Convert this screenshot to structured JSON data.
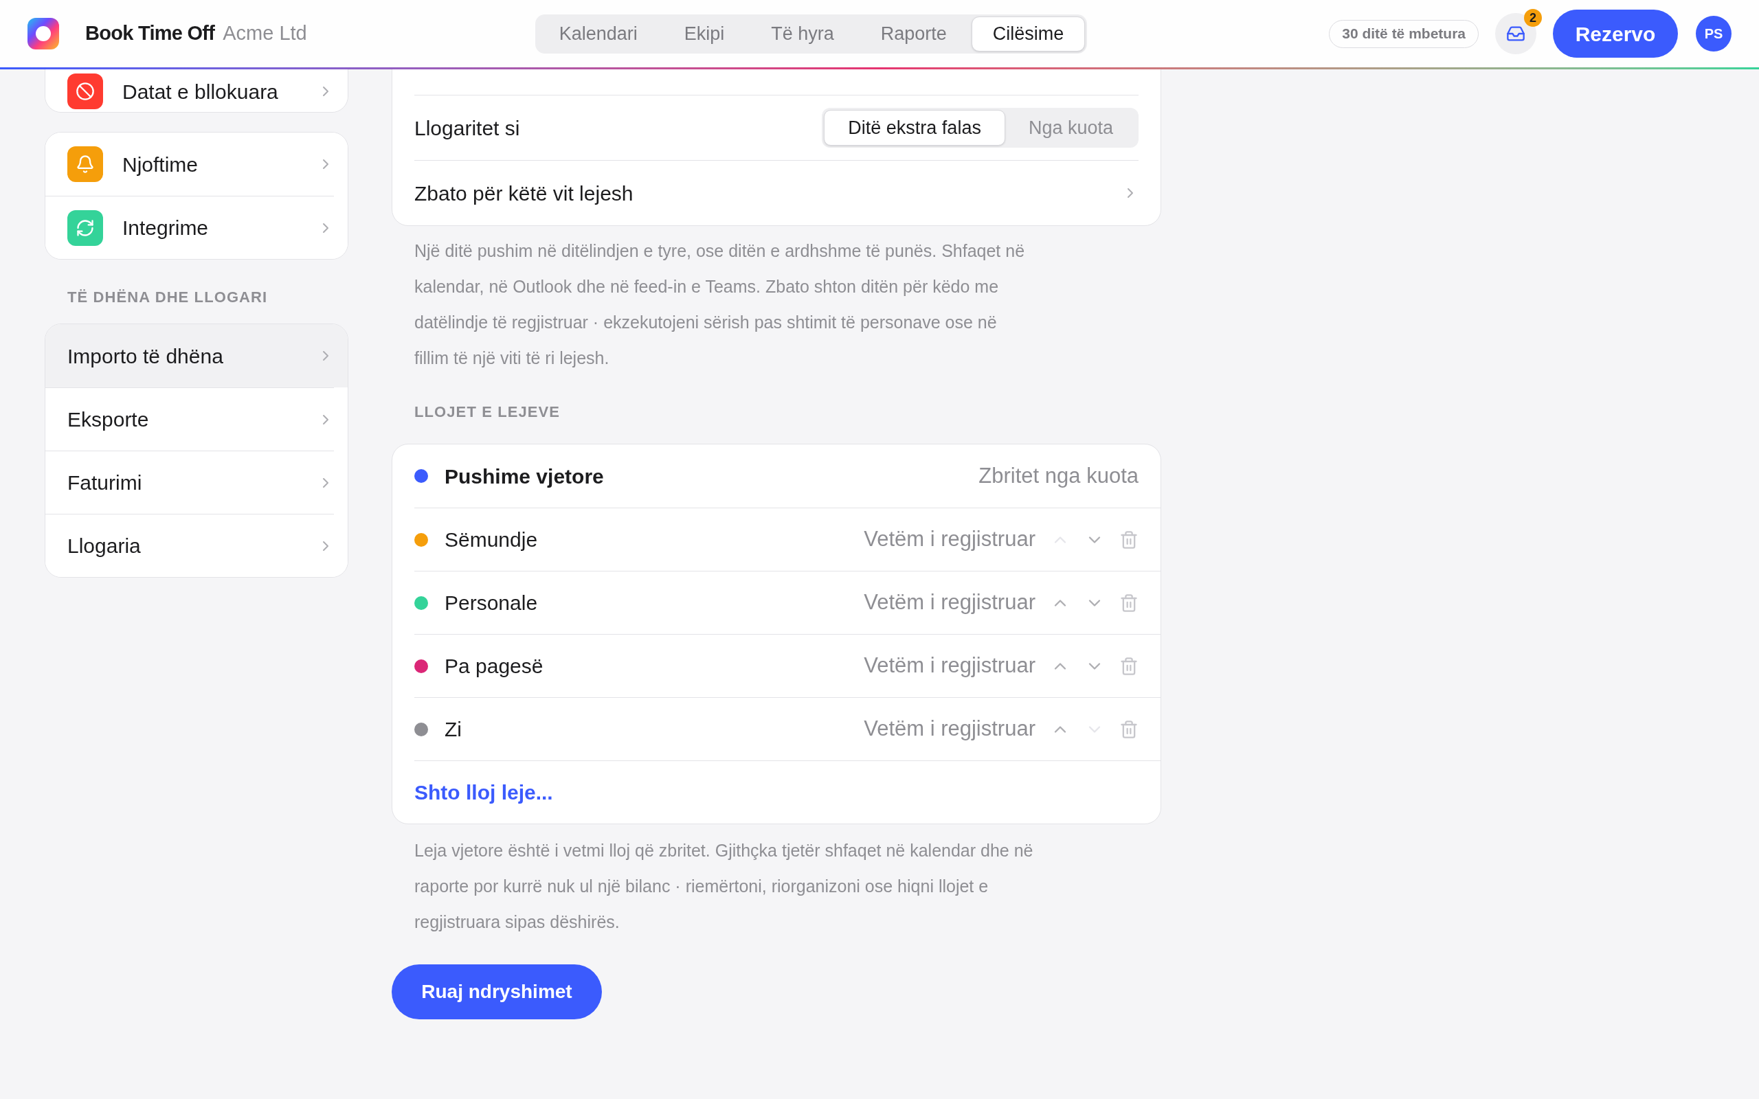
{
  "header": {
    "app_name": "Book Time Off",
    "company": "Acme Ltd",
    "tabs": [
      {
        "label": "Kalendari",
        "selected": false
      },
      {
        "label": "Ekipi",
        "selected": false
      },
      {
        "label": "Të hyra",
        "selected": false
      },
      {
        "label": "Raporte",
        "selected": false
      },
      {
        "label": "Cilësime",
        "selected": true
      }
    ],
    "days_left": "30 ditë të mbetura",
    "inbox_badge": "2",
    "book_button": "Rezervo",
    "avatar": "PS"
  },
  "sidebar": {
    "groups": [
      {
        "items": [
          {
            "label": "Datat e bllokuara",
            "color": "#ff3b30",
            "selected": false
          }
        ]
      },
      {
        "items": [
          {
            "label": "Njoftime",
            "color": "#f59e0b",
            "selected": false
          },
          {
            "label": "Integrime",
            "color": "#34d399",
            "selected": false
          }
        ]
      },
      {
        "title": "TË DHËNA DHE LLOGARI",
        "items": [
          {
            "label": "Importo të dhëna",
            "selected": true
          },
          {
            "label": "Eksporte",
            "selected": false
          },
          {
            "label": "Faturimi",
            "selected": false
          },
          {
            "label": "Llogaria",
            "selected": false
          }
        ]
      }
    ]
  },
  "birthday_section": {
    "rows": [
      {
        "kind": "segmented",
        "label": "Llogaritet si",
        "options": [
          {
            "label": "Ditë ekstra falas",
            "selected": true
          },
          {
            "label": "Nga kuota",
            "selected": false
          }
        ]
      },
      {
        "kind": "link",
        "label": "Zbato për këtë vit lejesh"
      }
    ],
    "note": "Një ditë pushim në ditëlindjen e tyre, ose ditën e ardhshme të punës. Shfaqet në kalendar, në Outlook dhe në feed-in e Teams. Zbato shton ditën për këdo me datëlindje të regjistruar · ekzekutojeni sërish pas shtimit të personave ose në fillim të një viti të ri lejesh."
  },
  "leave_types": {
    "title": "LLOJET E LEJEVE",
    "items": [
      {
        "kind": "fixed",
        "name": "Pushime vjetore",
        "color": "#3b5bfd",
        "mode": "Zbritet nga kuota"
      },
      {
        "kind": "custom",
        "name": "Sëmundje",
        "color": "#f59e0b",
        "mode": "Vetëm i regjistruar",
        "up_disabled": true,
        "down_disabled": false
      },
      {
        "kind": "custom",
        "name": "Personale",
        "color": "#34d399",
        "mode": "Vetëm i regjistruar",
        "up_disabled": false,
        "down_disabled": false
      },
      {
        "kind": "custom",
        "name": "Pa pagesë",
        "color": "#db2777",
        "mode": "Vetëm i regjistruar",
        "up_disabled": false,
        "down_disabled": false
      },
      {
        "kind": "custom",
        "name": "Zi",
        "color": "#8e8e93",
        "mode": "Vetëm i regjistruar",
        "up_disabled": false,
        "down_disabled": true
      }
    ],
    "add_link": "Shto lloj leje...",
    "note": "Leja vjetore është i vetmi lloj që zbritet. Gjithçka tjetër shfaqet në kalendar dhe në raporte por kurrë nuk ul një bilanc · riemërtoni, riorganizoni ose hiqni llojet e regjistruara sipas dëshirës."
  },
  "save_button": "Ruaj ndryshimet"
}
